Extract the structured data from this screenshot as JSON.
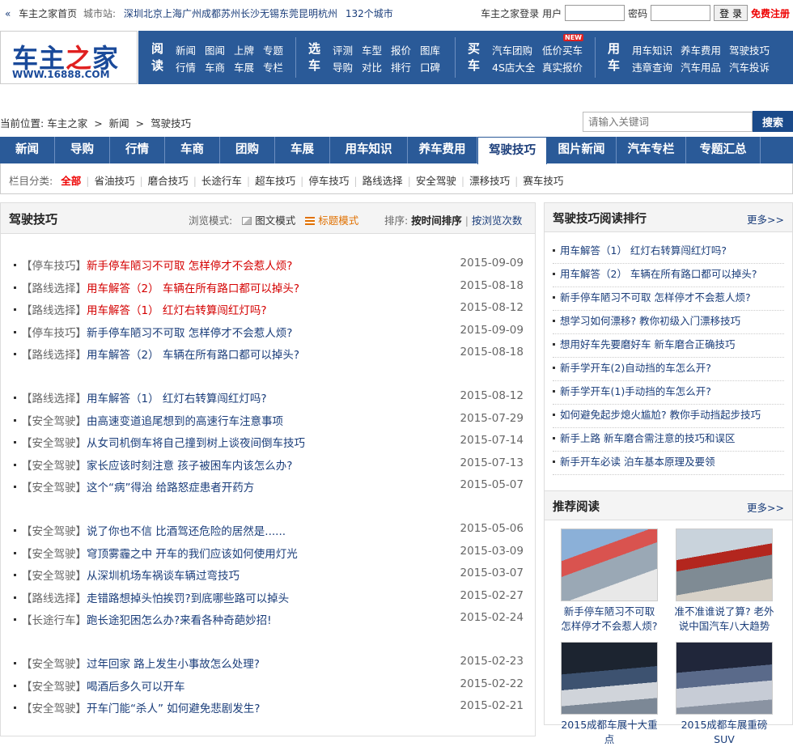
{
  "topbar": {
    "home": "车主之家首页",
    "city_label": "城市站:",
    "cities": [
      "深圳",
      "北京",
      "上海",
      "广州",
      "成都",
      "苏州",
      "长沙",
      "无锡",
      "东莞",
      "昆明",
      "杭州"
    ],
    "more_cities": "132个城市",
    "login_label": "车主之家登录",
    "user_label": "用户",
    "password_label": "密码",
    "login_button": "登 录",
    "register": "免费注册"
  },
  "logo": {
    "text_blue": "车主",
    "text_red": "之",
    "text_blue2": "家",
    "url": "WWW.16888.COM"
  },
  "mainnav": {
    "groups": [
      {
        "head": "阅读",
        "row1": [
          "新闻",
          "图闻",
          "上牌",
          "专题"
        ],
        "row2": [
          "行情",
          "车商",
          "车展",
          "专栏"
        ]
      },
      {
        "head": "选车",
        "row1": [
          "评测",
          "车型",
          "报价",
          "图库"
        ],
        "row2": [
          "导购",
          "对比",
          "排行",
          "口碑"
        ]
      },
      {
        "head": "买车",
        "row1": [
          "汽车团购",
          "低价买车"
        ],
        "row2": [
          "4S店大全",
          "真实报价"
        ],
        "badge": "NEW"
      },
      {
        "head": "用车",
        "row1": [
          "用车知识",
          "养车费用",
          "驾驶技巧"
        ],
        "row2": [
          "违章查询",
          "汽车用品",
          "汽车投诉"
        ]
      }
    ]
  },
  "breadcrumb": {
    "label": "当前位置:",
    "items": [
      "车主之家",
      "新闻",
      "驾驶技巧"
    ],
    "sep": ">"
  },
  "search": {
    "placeholder": "请输入关键词",
    "button": "搜索"
  },
  "tabs": [
    {
      "label": "新闻",
      "active": false
    },
    {
      "label": "导购",
      "active": false
    },
    {
      "label": "行情",
      "active": false
    },
    {
      "label": "车商",
      "active": false
    },
    {
      "label": "团购",
      "active": false
    },
    {
      "label": "车展",
      "active": false
    },
    {
      "label": "用车知识",
      "active": false
    },
    {
      "label": "养车费用",
      "active": false
    },
    {
      "label": "驾驶技巧",
      "active": true
    },
    {
      "label": "图片新闻",
      "active": false
    },
    {
      "label": "汽车专栏",
      "active": false
    },
    {
      "label": "专题汇总",
      "active": false
    }
  ],
  "catbar": {
    "label": "栏目分类:",
    "items": [
      "全部",
      "省油技巧",
      "磨合技巧",
      "长途行车",
      "超车技巧",
      "停车技巧",
      "路线选择",
      "安全驾驶",
      "漂移技巧",
      "赛车技巧"
    ]
  },
  "main": {
    "title": "驾驶技巧",
    "mode_label": "浏览模式:",
    "mode_pic": "图文模式",
    "mode_title": "标题模式",
    "sort_label": "排序:",
    "sort_time": "按时间排序",
    "sort_sep": "|",
    "sort_views": "按浏览次数",
    "rows": [
      {
        "cat": "【停车技巧】",
        "title": "新手停车陋习不可取 怎样停才不会惹人烦?",
        "date": "2015-09-09",
        "red": true
      },
      {
        "cat": "【路线选择】",
        "title": "用车解答（2） 车辆在所有路口都可以掉头?",
        "date": "2015-08-18",
        "red": true
      },
      {
        "cat": "【路线选择】",
        "title": "用车解答（1） 红灯右转算闯红灯吗?",
        "date": "2015-08-12",
        "red": true
      },
      {
        "cat": "【停车技巧】",
        "title": "新手停车陋习不可取 怎样停才不会惹人烦?",
        "date": "2015-09-09",
        "red": false
      },
      {
        "cat": "【路线选择】",
        "title": "用车解答（2） 车辆在所有路口都可以掉头?",
        "date": "2015-08-18",
        "red": false
      },
      {
        "cat": "【路线选择】",
        "title": "用车解答（1） 红灯右转算闯红灯吗?",
        "date": "2015-08-12",
        "red": false
      },
      {
        "cat": "【安全驾驶】",
        "title": "由高速变道追尾想到的高速行车注意事项",
        "date": "2015-07-29",
        "red": false
      },
      {
        "cat": "【安全驾驶】",
        "title": "从女司机倒车将自己撞到树上谈夜间倒车技巧",
        "date": "2015-07-14",
        "red": false
      },
      {
        "cat": "【安全驾驶】",
        "title": "家长应该时刻注意 孩子被困车内该怎么办?",
        "date": "2015-07-13",
        "red": false
      },
      {
        "cat": "【安全驾驶】",
        "title": "这个“病”得治 给路怒症患者开药方",
        "date": "2015-05-07",
        "red": false
      },
      {
        "cat": "【安全驾驶】",
        "title": "说了你也不信 比酒驾还危险的居然是......",
        "date": "2015-05-06",
        "red": false
      },
      {
        "cat": "【安全驾驶】",
        "title": "穹顶雾霾之中 开车的我们应该如何使用灯光",
        "date": "2015-03-09",
        "red": false
      },
      {
        "cat": "【安全驾驶】",
        "title": "从深圳机场车祸谈车辆过弯技巧",
        "date": "2015-03-07",
        "red": false
      },
      {
        "cat": "【路线选择】",
        "title": "走错路想掉头怕挨罚?到底哪些路可以掉头",
        "date": "2015-02-27",
        "red": false
      },
      {
        "cat": "【长途行车】",
        "title": "跑长途犯困怎么办?来看各种奇葩妙招!",
        "date": "2015-02-24",
        "red": false
      },
      {
        "cat": "【安全驾驶】",
        "title": "过年回家 路上发生小事故怎么处理?",
        "date": "2015-02-23",
        "red": false
      },
      {
        "cat": "【安全驾驶】",
        "title": "喝酒后多久可以开车",
        "date": "2015-02-22",
        "red": false
      },
      {
        "cat": "【安全驾驶】",
        "title": "开车门能“杀人” 如何避免悲剧发生?",
        "date": "2015-02-21",
        "red": false
      }
    ]
  },
  "ranking": {
    "title": "驾驶技巧阅读排行",
    "more": "更多>>",
    "items": [
      "用车解答（1） 红灯右转算闯红灯吗?",
      "用车解答（2） 车辆在所有路口都可以掉头?",
      "新手停车陋习不可取 怎样停才不会惹人烦?",
      "想学习如何漂移? 教你初级入门漂移技巧",
      "想用好车先要磨好车 新车磨合正确技巧",
      "新手学开车(2)自动挡的车怎么开?",
      "新手学开车(1)手动挡的车怎么开?",
      "如何避免起步熄火尴尬? 教你手动挡起步技巧",
      "新手上路 新车磨合需注意的技巧和误区",
      "新手开车必读 泊车基本原理及要领"
    ]
  },
  "recommend": {
    "title": "推荐阅读",
    "more": "更多>>",
    "items": [
      {
        "caption": "新手停车陋习不可取 怎样停才不会惹人烦?"
      },
      {
        "caption": "准不准谁说了算? 老外说中国汽车八大趋势"
      },
      {
        "caption": "2015成都车展十大重点"
      },
      {
        "caption": "2015成都车展重磅SUV"
      }
    ]
  },
  "colors": {
    "nav_blue": "#2a5a98",
    "red": "#d40000",
    "link_blue": "#1a3d7a"
  }
}
